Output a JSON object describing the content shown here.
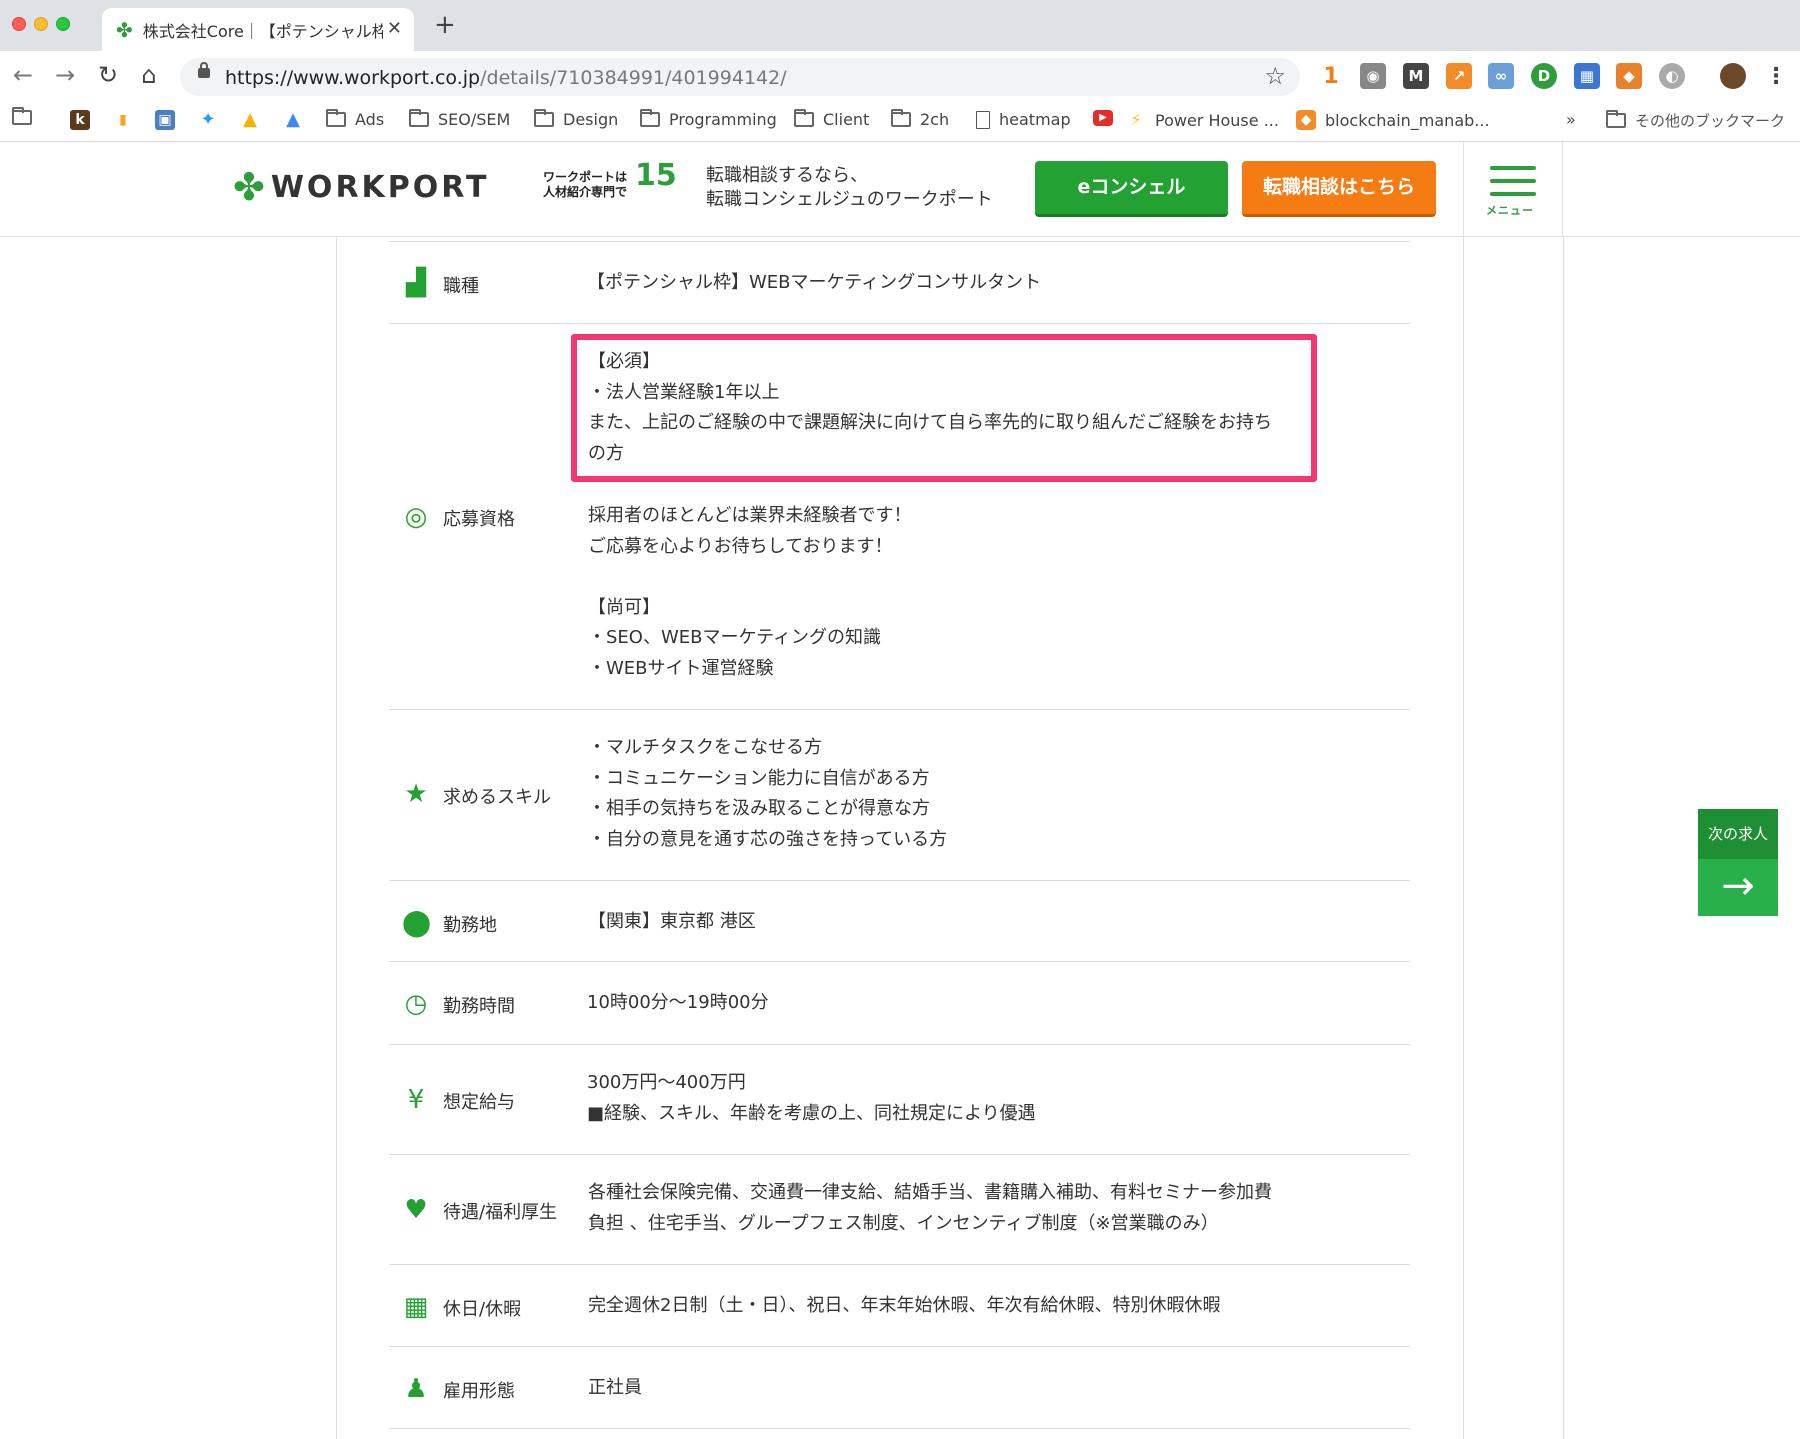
{
  "browser": {
    "tab_title": "株式会社Core｜【ポテンシャル枠】",
    "url_host": "https://www.workport.co.jp",
    "url_path": "/details/710384991/401994142/",
    "ext_badge": "1",
    "bookmarks": [
      {
        "label": "Ads",
        "icon": "folder-icon"
      },
      {
        "label": "SEO/SEM",
        "icon": "folder-icon"
      },
      {
        "label": "Design",
        "icon": "folder-icon"
      },
      {
        "label": "Programming",
        "icon": "folder-icon"
      },
      {
        "label": "Client",
        "icon": "folder-icon"
      },
      {
        "label": "2ch",
        "icon": "folder-icon"
      },
      {
        "label": "heatmap",
        "icon": "page-icon"
      },
      {
        "label": "Power House ...",
        "icon": "bolt-icon"
      },
      {
        "label": "blockchain_manab...",
        "icon": "cube-icon"
      }
    ],
    "bookmarks_more": "»",
    "other_bookmarks": "その他のブックマーク"
  },
  "site": {
    "logo_text": "WORKPORT",
    "badge_line1": "ワークポートは",
    "badge_line2": "人材紹介専門で",
    "badge_num": "15",
    "tagline_line1": "転職相談するなら、",
    "tagline_line2": "転職コンシェルジュのワークポート",
    "econ_button": "eコンシェル",
    "tenshoku_button": "転職相談はこちら",
    "menu_label": "メニュー"
  },
  "job": {
    "rows": [
      {
        "label": "職種",
        "icon": "job-type-icon",
        "lines": [
          "【ポテンシャル枠】WEBマーケティングコンサルタント"
        ]
      },
      {
        "label": "応募資格",
        "icon": "qualification-icon",
        "lines": [
          "【必須】",
          "・法人営業経験1年以上",
          "また、上記のご経験の中で課題解決に向けて自ら率先的に取り組んだご経験をお持ち",
          "の方",
          "採用者のほとんどは業界未経験者です！",
          "ご応募を心よりお待ちしております！",
          "【尚可】",
          "・SEO、WEBマーケティングの知識",
          "・WEBサイト運営経験"
        ]
      },
      {
        "label": "求めるスキル",
        "icon": "star-icon",
        "lines": [
          "・マルチタスクをこなせる方",
          "・コミュニケーション能力に自信がある方",
          "・相手の気持ちを汲み取ることが得意な方",
          "・自分の意見を通す芯の強さを持っている方"
        ]
      },
      {
        "label": "勤務地",
        "icon": "location-pin-icon",
        "lines": [
          "【関東】東京都 港区"
        ]
      },
      {
        "label": "勤務時間",
        "icon": "clock-icon",
        "lines": [
          "10時00分〜19時00分"
        ]
      },
      {
        "label": "想定給与",
        "icon": "yen-icon",
        "lines": [
          "300万円〜400万円",
          "■経験、スキル、年齢を考慮の上、同社規定により優遇"
        ]
      },
      {
        "label": "待遇/福利厚生",
        "icon": "heart-icon",
        "lines": [
          "各種社会保険完備、交通費一律支給、結婚手当、書籍購入補助、有料セミナー参加費",
          "負担 、住宅手当、グループフェス制度、インセンティブ制度（※営業職のみ）"
        ]
      },
      {
        "label": "休日/休暇",
        "icon": "calendar-icon",
        "lines": [
          "完全週休2日制（土・日）、祝日、年末年始休暇、年次有給休暇、特別休暇休暇"
        ]
      },
      {
        "label": "雇用形態",
        "icon": "person-icon",
        "lines": [
          "正社員"
        ]
      }
    ]
  },
  "next_job": {
    "label": "次の求人",
    "arrow": "→"
  },
  "colors": {
    "accent_green": "#23a233",
    "orange": "#f57c12",
    "highlight": "#f3386f"
  }
}
